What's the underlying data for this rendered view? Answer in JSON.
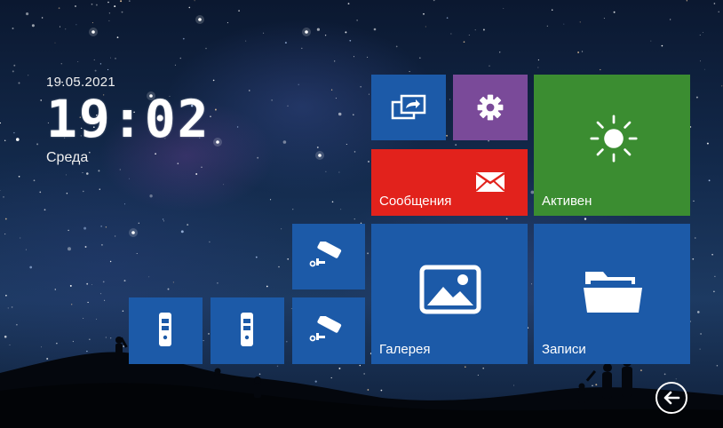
{
  "clock": {
    "date": "19.05.2021",
    "time": "19:02",
    "weekday": "Среда"
  },
  "tiles": {
    "messages": {
      "label": "Сообщения",
      "color": "#e2221c",
      "icon": "envelope-icon"
    },
    "mode": {
      "label": "Активен",
      "color": "#3b8d31",
      "icon": "sun-icon"
    },
    "gallery": {
      "label": "Галерея",
      "color": "#1c5aa8",
      "icon": "picture-icon"
    },
    "records": {
      "label": "Записи",
      "color": "#1c5aa8",
      "icon": "folder-icon"
    },
    "transfer": {
      "icon": "transfer-icon",
      "color": "#1c5aa8"
    },
    "settings": {
      "icon": "gear-icon",
      "color": "#7a4a99"
    },
    "camera1": {
      "icon": "cctv-camera-icon",
      "color": "#1c5aa8"
    },
    "camera2": {
      "icon": "cctv-camera-icon",
      "color": "#1c5aa8"
    },
    "panel1": {
      "icon": "door-panel-icon",
      "color": "#1c5aa8"
    },
    "panel2": {
      "icon": "door-panel-icon",
      "color": "#1c5aa8"
    }
  },
  "back": {
    "icon": "back-arrow-icon"
  }
}
